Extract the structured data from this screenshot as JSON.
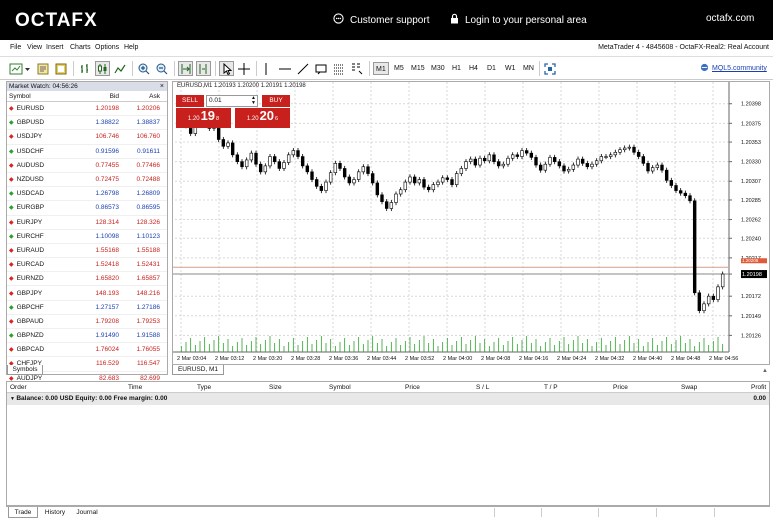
{
  "topbar": {
    "logo": "OCTAFX",
    "support": "Customer support",
    "login": "Login to your personal area",
    "site": "octafx.com"
  },
  "menu": [
    "File",
    "View",
    "Insert",
    "Charts",
    "Options",
    "Help"
  ],
  "account_info": "MetaTrader 4 - 4845608 - OctaFX-Real2: Real Account",
  "timeframes": [
    "M1",
    "M5",
    "M15",
    "M30",
    "H1",
    "H4",
    "D1",
    "W1",
    "MN"
  ],
  "active_timeframe": "M1",
  "mql5_link": "MQL5.community",
  "market_watch": {
    "title": "Market Watch: 04:56:26",
    "close_glyph": "×",
    "headers": {
      "symbol": "Symbol",
      "bid": "Bid",
      "ask": "Ask"
    },
    "tab": "Symbols",
    "rows": [
      {
        "symbol": "EURUSD",
        "bid": "1.20198",
        "ask": "1.20206",
        "dir": "dn"
      },
      {
        "symbol": "GBPUSD",
        "bid": "1.38822",
        "ask": "1.38837",
        "dir": "up"
      },
      {
        "symbol": "USDJPY",
        "bid": "106.746",
        "ask": "106.760",
        "dir": "dn"
      },
      {
        "symbol": "USDCHF",
        "bid": "0.91596",
        "ask": "0.91611",
        "dir": "up"
      },
      {
        "symbol": "AUDUSD",
        "bid": "0.77455",
        "ask": "0.77466",
        "dir": "dn"
      },
      {
        "symbol": "NZDUSD",
        "bid": "0.72475",
        "ask": "0.72488",
        "dir": "dn"
      },
      {
        "symbol": "USDCAD",
        "bid": "1.26798",
        "ask": "1.26809",
        "dir": "up"
      },
      {
        "symbol": "EURGBP",
        "bid": "0.86573",
        "ask": "0.86595",
        "dir": "up"
      },
      {
        "symbol": "EURJPY",
        "bid": "128.314",
        "ask": "128.326",
        "dir": "dn"
      },
      {
        "symbol": "EURCHF",
        "bid": "1.10098",
        "ask": "1.10123",
        "dir": "up"
      },
      {
        "symbol": "EURAUD",
        "bid": "1.55168",
        "ask": "1.55188",
        "dir": "dn"
      },
      {
        "symbol": "EURCAD",
        "bid": "1.52418",
        "ask": "1.52431",
        "dir": "dn"
      },
      {
        "symbol": "EURNZD",
        "bid": "1.65820",
        "ask": "1.65857",
        "dir": "dn"
      },
      {
        "symbol": "GBPJPY",
        "bid": "148.193",
        "ask": "148.216",
        "dir": "dn"
      },
      {
        "symbol": "GBPCHF",
        "bid": "1.27157",
        "ask": "1.27186",
        "dir": "up"
      },
      {
        "symbol": "GBPAUD",
        "bid": "1.79208",
        "ask": "1.79253",
        "dir": "dn"
      },
      {
        "symbol": "GBPNZD",
        "bid": "1.91490",
        "ask": "1.91588",
        "dir": "up"
      },
      {
        "symbol": "GBPCAD",
        "bid": "1.76024",
        "ask": "1.76055",
        "dir": "dn"
      },
      {
        "symbol": "CHFJPY",
        "bid": "116.529",
        "ask": "116.547",
        "dir": "dn"
      },
      {
        "symbol": "AUDJPY",
        "bid": "82.683",
        "ask": "82.699",
        "dir": "dn"
      }
    ]
  },
  "chart": {
    "title": "EURUSD,M1  1.20193 1.20200 1.20191 1.20198",
    "tab": "EURUSD, M1",
    "one_click": {
      "sell": "SELL",
      "buy": "BUY",
      "lot": "0.01",
      "sell_small": "1.20",
      "sell_big": "19",
      "sell_sup": "8",
      "buy_small": "1.20",
      "buy_big": "20",
      "buy_sup": "6"
    },
    "price_labels": [
      "1.20398",
      "1.20375",
      "1.20353",
      "1.20330",
      "1.20307",
      "1.20285",
      "1.20262",
      "1.20240",
      "1.20217",
      "1.20198",
      "1.20172",
      "1.20149",
      "1.20126"
    ],
    "current_price": "1.20198",
    "ask_price": "1.20206",
    "time_labels": [
      "2 Mar 03:04",
      "2 Mar 03:12",
      "2 Mar 03:20",
      "2 Mar 03:28",
      "2 Mar 03:36",
      "2 Mar 03:44",
      "2 Mar 03:52",
      "2 Mar 04:00",
      "2 Mar 04:08",
      "2 Mar 04:16",
      "2 Mar 04:24",
      "2 Mar 04:32",
      "2 Mar 04:40",
      "2 Mar 04:48",
      "2 Mar 04:56"
    ],
    "colors": {
      "bull": "#ffffff",
      "bear": "#000000",
      "ask_line": "#d4a08a",
      "bid_line": "#888888"
    }
  },
  "chart_data": {
    "type": "candlestick",
    "ylim": [
      1.2011,
      1.2042
    ],
    "x": [
      "03:00",
      "03:01",
      "03:02",
      "03:03",
      "03:04",
      "03:05",
      "03:06",
      "03:07",
      "03:08",
      "03:09",
      "03:10",
      "03:11",
      "03:12",
      "03:13",
      "03:14",
      "03:15",
      "03:16",
      "03:17",
      "03:18",
      "03:19",
      "03:20",
      "03:21",
      "03:22",
      "03:23",
      "03:24",
      "03:25",
      "03:26",
      "03:27",
      "03:28",
      "03:29",
      "03:30",
      "03:31",
      "03:32",
      "03:33",
      "03:34",
      "03:35",
      "03:36",
      "03:37",
      "03:38",
      "03:39",
      "03:40",
      "03:41",
      "03:42",
      "03:43",
      "03:44",
      "03:45",
      "03:46",
      "03:47",
      "03:48",
      "03:49",
      "03:50",
      "03:51",
      "03:52",
      "03:53",
      "03:54",
      "03:55",
      "03:56",
      "03:57",
      "03:58",
      "03:59",
      "04:00",
      "04:01",
      "04:02",
      "04:03",
      "04:04",
      "04:05",
      "04:06",
      "04:07",
      "04:08",
      "04:09",
      "04:10",
      "04:11",
      "04:12",
      "04:13",
      "04:14",
      "04:15",
      "04:16",
      "04:17",
      "04:18",
      "04:19",
      "04:20",
      "04:21",
      "04:22",
      "04:23",
      "04:24",
      "04:25",
      "04:26",
      "04:27",
      "04:28",
      "04:29",
      "04:30",
      "04:31",
      "04:32",
      "04:33",
      "04:34",
      "04:35",
      "04:36",
      "04:37",
      "04:38",
      "04:39",
      "04:40",
      "04:41",
      "04:42",
      "04:43",
      "04:44",
      "04:45",
      "04:46",
      "04:47",
      "04:48",
      "04:49",
      "04:50",
      "04:51",
      "04:52",
      "04:53",
      "04:54",
      "04:55",
      "04:56"
    ],
    "close": [
      1.20381,
      1.20372,
      1.20363,
      1.20375,
      1.20383,
      1.20378,
      1.20369,
      1.20374,
      1.20356,
      1.20348,
      1.20352,
      1.20338,
      1.2033,
      1.20324,
      1.20332,
      1.2034,
      1.20327,
      1.20318,
      1.20325,
      1.20336,
      1.2033,
      1.20322,
      1.20329,
      1.20338,
      1.20343,
      1.20336,
      1.20325,
      1.20318,
      1.20309,
      1.20301,
      1.20296,
      1.20306,
      1.20317,
      1.20328,
      1.20322,
      1.20312,
      1.20305,
      1.20309,
      1.20318,
      1.20324,
      1.20316,
      1.20305,
      1.20291,
      1.20283,
      1.20275,
      1.20282,
      1.20292,
      1.20297,
      1.20306,
      1.20312,
      1.20305,
      1.20309,
      1.203,
      1.20297,
      1.20303,
      1.20306,
      1.20311,
      1.20309,
      1.20303,
      1.20316,
      1.20322,
      1.2033,
      1.20333,
      1.20326,
      1.20334,
      1.20331,
      1.20338,
      1.2033,
      1.20325,
      1.20327,
      1.20334,
      1.20338,
      1.20336,
      1.20343,
      1.2034,
      1.20335,
      1.20326,
      1.2032,
      1.20327,
      1.20335,
      1.2033,
      1.20325,
      1.20319,
      1.20321,
      1.20326,
      1.20333,
      1.20328,
      1.20324,
      1.20327,
      1.20331,
      1.20336,
      1.20336,
      1.20338,
      1.20341,
      1.20344,
      1.20346,
      1.20347,
      1.20341,
      1.20336,
      1.20328,
      1.20319,
      1.20323,
      1.20326,
      1.2032,
      1.20308,
      1.20302,
      1.20296,
      1.20293,
      1.2029,
      1.20284,
      1.20176,
      1.20155,
      1.20163,
      1.20172,
      1.20168,
      1.20183,
      1.20198
    ]
  },
  "terminal": {
    "headers": [
      "Order",
      "Time",
      "Type",
      "Size",
      "Symbol",
      "Price",
      "S / L",
      "T / P",
      "Price",
      "Swap",
      "Profit"
    ],
    "balance_line": "Balance: 0.00 USD  Equity: 0.00  Free margin: 0.00",
    "profit": "0.00",
    "tabs": [
      "Trade",
      "History",
      "Journal"
    ]
  }
}
